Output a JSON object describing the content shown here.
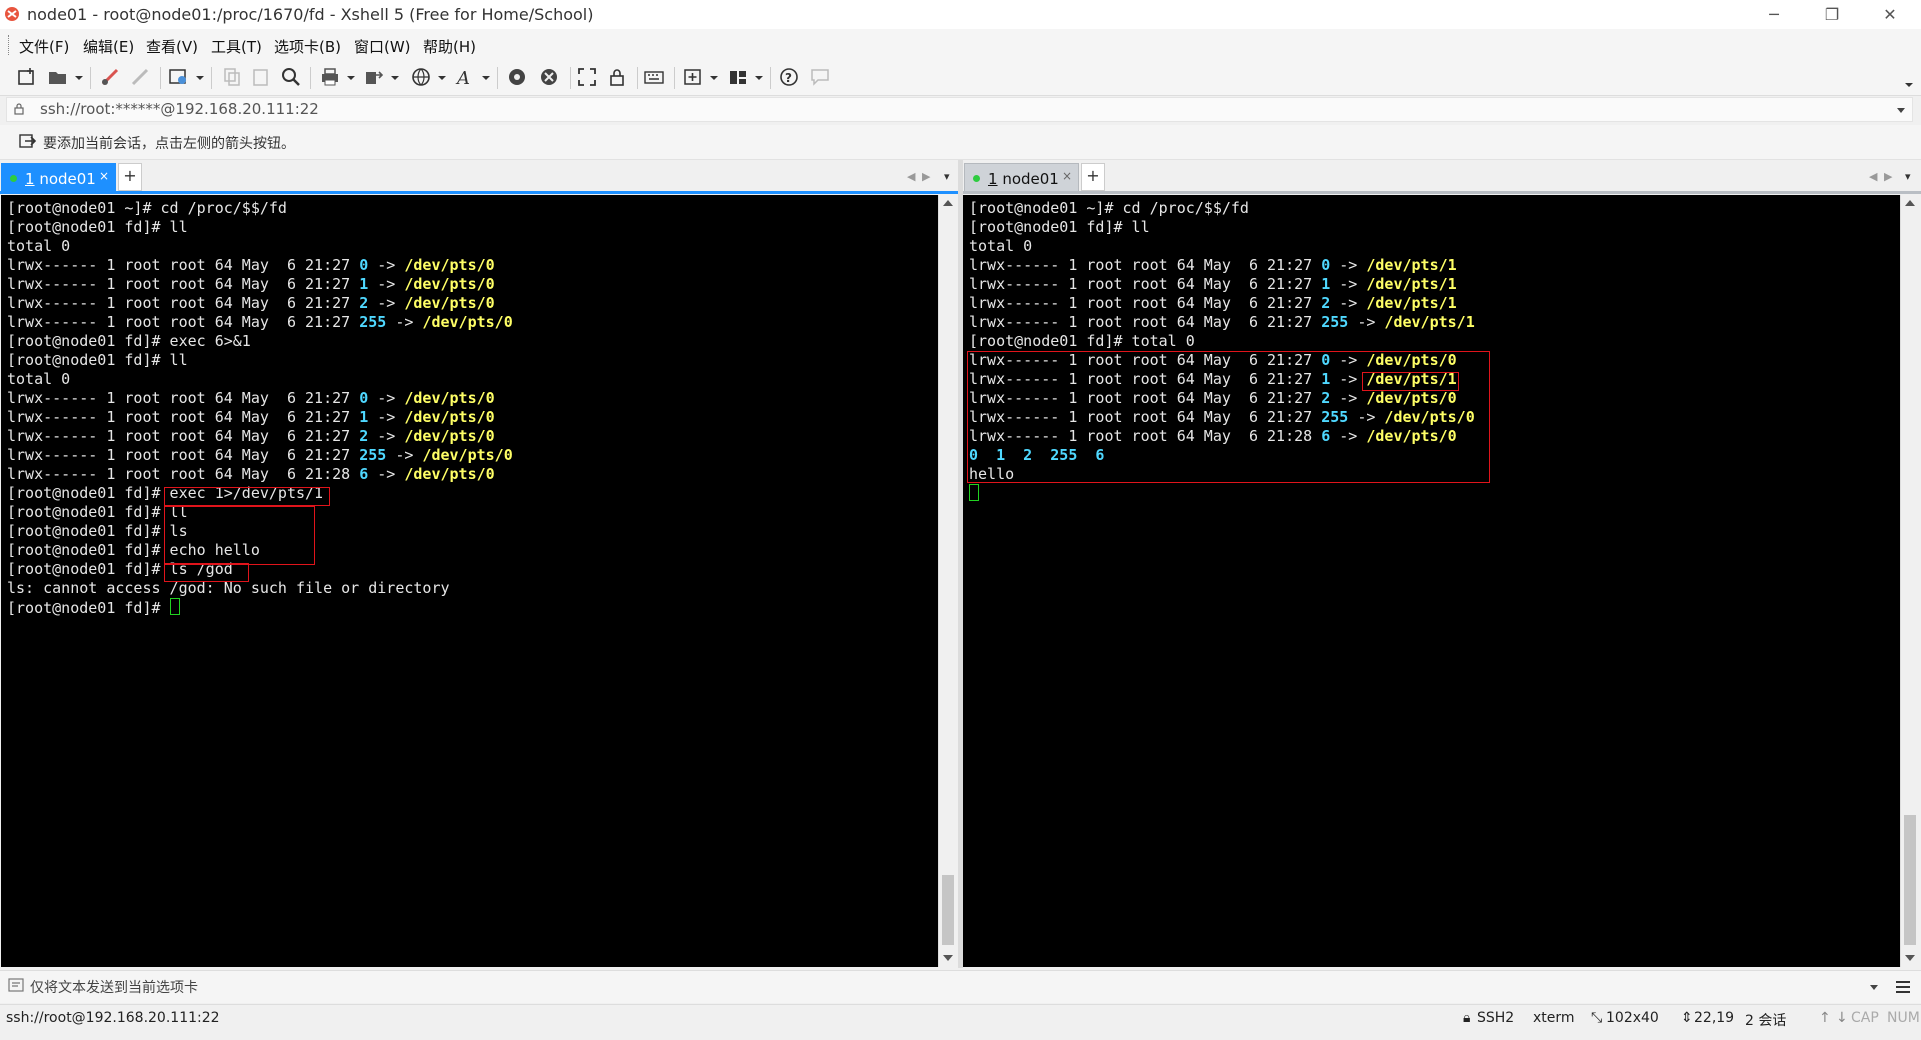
{
  "window": {
    "title": "node01 - root@node01:/proc/1670/fd - Xshell 5 (Free for Home/School)",
    "minimize": "─",
    "restore": "❐",
    "close": "✕"
  },
  "menu": {
    "items": [
      "文件(F)",
      "编辑(E)",
      "查看(V)",
      "工具(T)",
      "选项卡(B)",
      "窗口(W)",
      "帮助(H)"
    ]
  },
  "toolbar": {
    "icons": [
      "new-session-icon",
      "open-folder-icon",
      "connect-icon",
      "disconnect-icon",
      "properties-icon",
      "copy-icon",
      "paste-icon",
      "find-icon",
      "print-icon",
      "transfer-icon",
      "globe-icon",
      "font-icon",
      "xftp-icon",
      "xmanager-icon",
      "fullscreen-icon",
      "lock-icon",
      "keyboard-icon",
      "add-session-icon",
      "layout-icon",
      "help-icon",
      "chat-icon"
    ]
  },
  "address": {
    "value": "ssh://root:******@192.168.20.111:22"
  },
  "hint": {
    "text": "要添加当前会话，点击左侧的箭头按钮。"
  },
  "tabs": {
    "left": {
      "number": "1",
      "name": "node01",
      "close": "×",
      "add": "+"
    },
    "right": {
      "number": "1",
      "name": "node01",
      "close": "×",
      "add": "+"
    }
  },
  "left_terminal": {
    "lines": [
      [
        {
          "t": "[root@node01 ~]# cd /proc/$$/fd"
        }
      ],
      [
        {
          "t": "[root@node01 fd]# ll"
        }
      ],
      [
        {
          "t": "total 0"
        }
      ],
      [
        {
          "t": "lrwx------ 1 root root 64 May  6 21:27 "
        },
        {
          "t": "0",
          "c": "fdn"
        },
        {
          "t": " -> "
        },
        {
          "t": "/dev/pts/0",
          "c": "dev"
        }
      ],
      [
        {
          "t": "lrwx------ 1 root root 64 May  6 21:27 "
        },
        {
          "t": "1",
          "c": "fdn"
        },
        {
          "t": " -> "
        },
        {
          "t": "/dev/pts/0",
          "c": "dev"
        }
      ],
      [
        {
          "t": "lrwx------ 1 root root 64 May  6 21:27 "
        },
        {
          "t": "2",
          "c": "fdn"
        },
        {
          "t": " -> "
        },
        {
          "t": "/dev/pts/0",
          "c": "dev"
        }
      ],
      [
        {
          "t": "lrwx------ 1 root root 64 May  6 21:27 "
        },
        {
          "t": "255",
          "c": "fdn"
        },
        {
          "t": " -> "
        },
        {
          "t": "/dev/pts/0",
          "c": "dev"
        }
      ],
      [
        {
          "t": "[root@node01 fd]# exec 6>&1"
        }
      ],
      [
        {
          "t": "[root@node01 fd]# ll"
        }
      ],
      [
        {
          "t": "total 0"
        }
      ],
      [
        {
          "t": "lrwx------ 1 root root 64 May  6 21:27 "
        },
        {
          "t": "0",
          "c": "fdn"
        },
        {
          "t": " -> "
        },
        {
          "t": "/dev/pts/0",
          "c": "dev"
        }
      ],
      [
        {
          "t": "lrwx------ 1 root root 64 May  6 21:27 "
        },
        {
          "t": "1",
          "c": "fdn"
        },
        {
          "t": " -> "
        },
        {
          "t": "/dev/pts/0",
          "c": "dev"
        }
      ],
      [
        {
          "t": "lrwx------ 1 root root 64 May  6 21:27 "
        },
        {
          "t": "2",
          "c": "fdn"
        },
        {
          "t": " -> "
        },
        {
          "t": "/dev/pts/0",
          "c": "dev"
        }
      ],
      [
        {
          "t": "lrwx------ 1 root root 64 May  6 21:27 "
        },
        {
          "t": "255",
          "c": "fdn"
        },
        {
          "t": " -> "
        },
        {
          "t": "/dev/pts/0",
          "c": "dev"
        }
      ],
      [
        {
          "t": "lrwx------ 1 root root 64 May  6 21:28 "
        },
        {
          "t": "6",
          "c": "fdn"
        },
        {
          "t": " -> "
        },
        {
          "t": "/dev/pts/0",
          "c": "dev"
        }
      ],
      [
        {
          "t": "[root@node01 fd]# exec 1>/dev/pts/1"
        }
      ],
      [
        {
          "t": "[root@node01 fd]# ll"
        }
      ],
      [
        {
          "t": "[root@node01 fd]# ls"
        }
      ],
      [
        {
          "t": "[root@node01 fd]# echo hello"
        }
      ],
      [
        {
          "t": "[root@node01 fd]# ls /god"
        }
      ],
      [
        {
          "t": "ls: cannot access /god: No such file or directory"
        }
      ],
      [
        {
          "t": "[root@node01 fd]# "
        },
        {
          "cursor": true
        }
      ]
    ]
  },
  "right_terminal": {
    "lines": [
      [
        {
          "t": "[root@node01 ~]# cd /proc/$$/fd"
        }
      ],
      [
        {
          "t": "[root@node01 fd]# ll"
        }
      ],
      [
        {
          "t": "total 0"
        }
      ],
      [
        {
          "t": "lrwx------ 1 root root 64 May  6 21:27 "
        },
        {
          "t": "0",
          "c": "fdn"
        },
        {
          "t": " -> "
        },
        {
          "t": "/dev/pts/1",
          "c": "dev"
        }
      ],
      [
        {
          "t": "lrwx------ 1 root root 64 May  6 21:27 "
        },
        {
          "t": "1",
          "c": "fdn"
        },
        {
          "t": " -> "
        },
        {
          "t": "/dev/pts/1",
          "c": "dev"
        }
      ],
      [
        {
          "t": "lrwx------ 1 root root 64 May  6 21:27 "
        },
        {
          "t": "2",
          "c": "fdn"
        },
        {
          "t": " -> "
        },
        {
          "t": "/dev/pts/1",
          "c": "dev"
        }
      ],
      [
        {
          "t": "lrwx------ 1 root root 64 May  6 21:27 "
        },
        {
          "t": "255",
          "c": "fdn"
        },
        {
          "t": " -> "
        },
        {
          "t": "/dev/pts/1",
          "c": "dev"
        }
      ],
      [
        {
          "t": "[root@node01 fd]# total 0"
        }
      ],
      [
        {
          "t": "lrwx------ 1 root root 64 May  6 21:27 "
        },
        {
          "t": "0",
          "c": "fdn"
        },
        {
          "t": " -> "
        },
        {
          "t": "/dev/pts/0",
          "c": "dev"
        }
      ],
      [
        {
          "t": "lrwx------ 1 root root 64 May  6 21:27 "
        },
        {
          "t": "1",
          "c": "fdn"
        },
        {
          "t": " -> "
        },
        {
          "t": "/dev/pts/1",
          "c": "dev"
        }
      ],
      [
        {
          "t": "lrwx------ 1 root root 64 May  6 21:27 "
        },
        {
          "t": "2",
          "c": "fdn"
        },
        {
          "t": " -> "
        },
        {
          "t": "/dev/pts/0",
          "c": "dev"
        }
      ],
      [
        {
          "t": "lrwx------ 1 root root 64 May  6 21:27 "
        },
        {
          "t": "255",
          "c": "fdn"
        },
        {
          "t": " -> "
        },
        {
          "t": "/dev/pts/0",
          "c": "dev"
        }
      ],
      [
        {
          "t": "lrwx------ 1 root root 64 May  6 21:28 "
        },
        {
          "t": "6",
          "c": "fdn"
        },
        {
          "t": " -> "
        },
        {
          "t": "/dev/pts/0",
          "c": "dev"
        }
      ],
      [
        {
          "t": "0  1  2  255  6",
          "c": "fdn"
        }
      ],
      [
        {
          "t": "hello"
        }
      ],
      [
        {
          "cursor": true
        }
      ]
    ]
  },
  "compose": {
    "text": "仅将文本发送到当前选项卡"
  },
  "status": {
    "connection": "ssh://root@192.168.20.111:22",
    "protocol": "SSH2",
    "terminal": "xterm",
    "size": "102x40",
    "cursor_pos": "22,19",
    "sessions": "2 会话",
    "caps": "CAP",
    "num": "NUM"
  },
  "colors": {
    "terminal_bg": "#000000",
    "terminal_fg": "#e6e6e6",
    "fd_number": "#4fd8ff",
    "device_path": "#ffff66",
    "cursor": "#21d321",
    "highlight_box": "#e0141b",
    "tab_active": "#1e90ff"
  }
}
